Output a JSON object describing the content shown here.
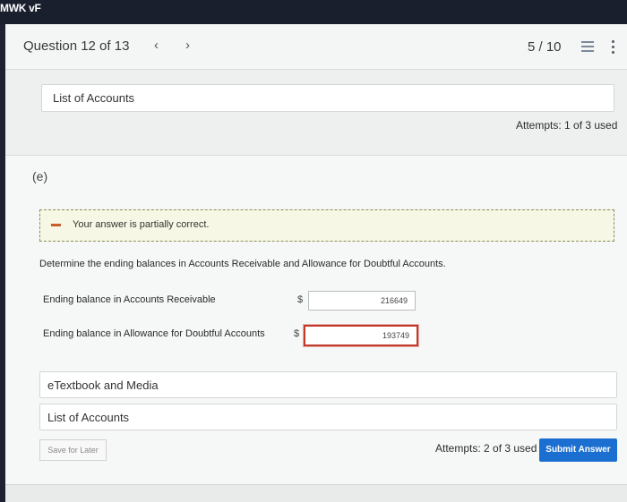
{
  "topbar": {
    "brand": "MWK vF"
  },
  "header": {
    "question_title": "Question 12 of 13",
    "prev_icon": "chevron-left-icon",
    "next_icon": "chevron-right-icon",
    "score": "5 / 10",
    "list_icon": "list-icon",
    "more_icon": "kebab-menu-icon"
  },
  "prev_part": {
    "list_of_accounts": "List of Accounts",
    "attempts": "Attempts: 1 of 3 used"
  },
  "part": {
    "label": "(e)",
    "feedback": "Your answer is partially correct.",
    "instruction": "Determine the ending balances in Accounts Receivable and Allowance for Doubtful Accounts.",
    "rows": [
      {
        "label": "Ending balance in Accounts Receivable",
        "currency": "$",
        "value": "216649",
        "status": "correct"
      },
      {
        "label": "Ending balance in Allowance for Doubtful Accounts",
        "currency": "$",
        "value": "193749",
        "status": "incorrect"
      }
    ],
    "etextbook": "eTextbook and Media",
    "list_of_accounts": "List of Accounts",
    "save_label": "Save for Later",
    "attempts": "Attempts: 2 of 3 used",
    "submit_label": "Submit Answer"
  },
  "colors": {
    "submit": "#1a6fd0",
    "incorrect_border": "#c0392b",
    "feedback_dash": "#c95d2a"
  }
}
